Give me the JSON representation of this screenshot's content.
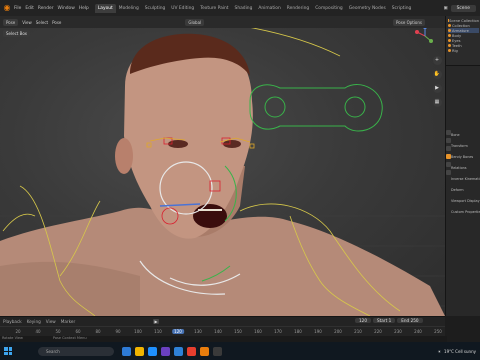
{
  "topbar": {
    "menus": [
      "File",
      "Edit",
      "Render",
      "Window",
      "Help"
    ],
    "tabs": [
      "Layout",
      "Modeling",
      "Sculpting",
      "UV Editing",
      "Texture Paint",
      "Shading",
      "Animation",
      "Rendering",
      "Compositing",
      "Geometry Nodes",
      "Scripting"
    ],
    "active_tab": "Layout",
    "scene": "Scene"
  },
  "viewport": {
    "mode": "Pose",
    "view_menu": [
      "View",
      "Select",
      "Pose"
    ],
    "orientation": "Global",
    "select_box": "Select Box",
    "pose_options": "Pose Options"
  },
  "outliner": {
    "rows": [
      "Scene Collection",
      "Collection",
      "Armature",
      "Body",
      "Eyes",
      "Teeth",
      "Rig"
    ]
  },
  "properties": {
    "items": [
      "Bone",
      "Transform",
      "Bendy Bones",
      "Relations",
      "Inverse Kinematics",
      "Deform",
      "Viewport Display",
      "Custom Properties"
    ]
  },
  "timeline": {
    "controls": [
      "Playback",
      "Keying",
      "View",
      "Marker"
    ],
    "start_label": "Start",
    "start": "1",
    "end_label": "End",
    "end": "250",
    "current": "120",
    "ticks": [
      "20",
      "40",
      "50",
      "60",
      "80",
      "90",
      "100",
      "110",
      "120",
      "130",
      "140",
      "150",
      "160",
      "170",
      "180",
      "190",
      "200",
      "210",
      "220",
      "230",
      "240",
      "250"
    ]
  },
  "status": {
    "left": "Rotate View",
    "middle": "Pose Context Menu"
  },
  "taskbar": {
    "search": "Search",
    "weather": "19°C  Cell sunny",
    "icons": [
      "#2e7bd6",
      "#f0b400",
      "#1e90ff",
      "#6a40c0",
      "#2f82d8",
      "#e63e2e",
      "#e87d0d",
      "#3a3a3a"
    ]
  }
}
